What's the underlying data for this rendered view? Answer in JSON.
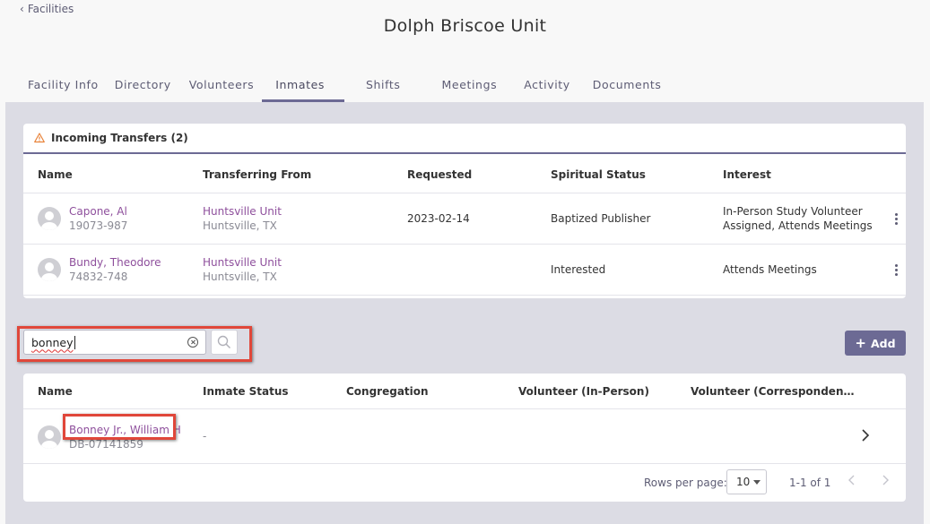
{
  "nav": {
    "back_label": "Facilities"
  },
  "page": {
    "title": "Dolph Briscoe Unit"
  },
  "tabs": [
    {
      "label": "Facility Info"
    },
    {
      "label": "Directory"
    },
    {
      "label": "Volunteers"
    },
    {
      "label": "Inmates",
      "active": true
    },
    {
      "label": "Shifts"
    },
    {
      "label": "Meetings"
    },
    {
      "label": "Activity"
    },
    {
      "label": "Documents"
    }
  ],
  "transfers": {
    "title": "Incoming Transfers (2)",
    "columns": [
      "Name",
      "Transferring From",
      "Requested",
      "Spiritual Status",
      "Interest"
    ],
    "rows": [
      {
        "name": "Capone, Al",
        "id": "19073-987",
        "from": "Huntsville Unit",
        "from_location": "Huntsville, TX",
        "requested": "2023-02-14",
        "status": "Baptized Publisher",
        "interest": "In-Person Study Volunteer Assigned, Attends Meetings"
      },
      {
        "name": "Bundy, Theodore",
        "id": "74832-748",
        "from": "Huntsville Unit",
        "from_location": "Huntsville, TX",
        "requested": "",
        "status": "Interested",
        "interest": "Attends Meetings"
      }
    ]
  },
  "search": {
    "value": "bonney"
  },
  "add_button": {
    "label": "Add"
  },
  "inmates": {
    "columns": [
      "Name",
      "Inmate Status",
      "Congregation",
      "Volunteer (In-Person)",
      "Volunteer (Corresponden…"
    ],
    "rows": [
      {
        "name": "Bonney Jr., William H",
        "id": "DB-07141859",
        "status": "-",
        "congregation": "",
        "volunteer_in_person": "",
        "volunteer_correspondence": ""
      }
    ],
    "footer": {
      "rows_per_page_label": "Rows per page:",
      "rows_per_page": "10",
      "range": "1-1 of 1"
    }
  },
  "colors": {
    "accent": "#6c6a94",
    "link": "#8e4f9c",
    "highlight": "#e0473a",
    "warning": "#e8833a"
  }
}
